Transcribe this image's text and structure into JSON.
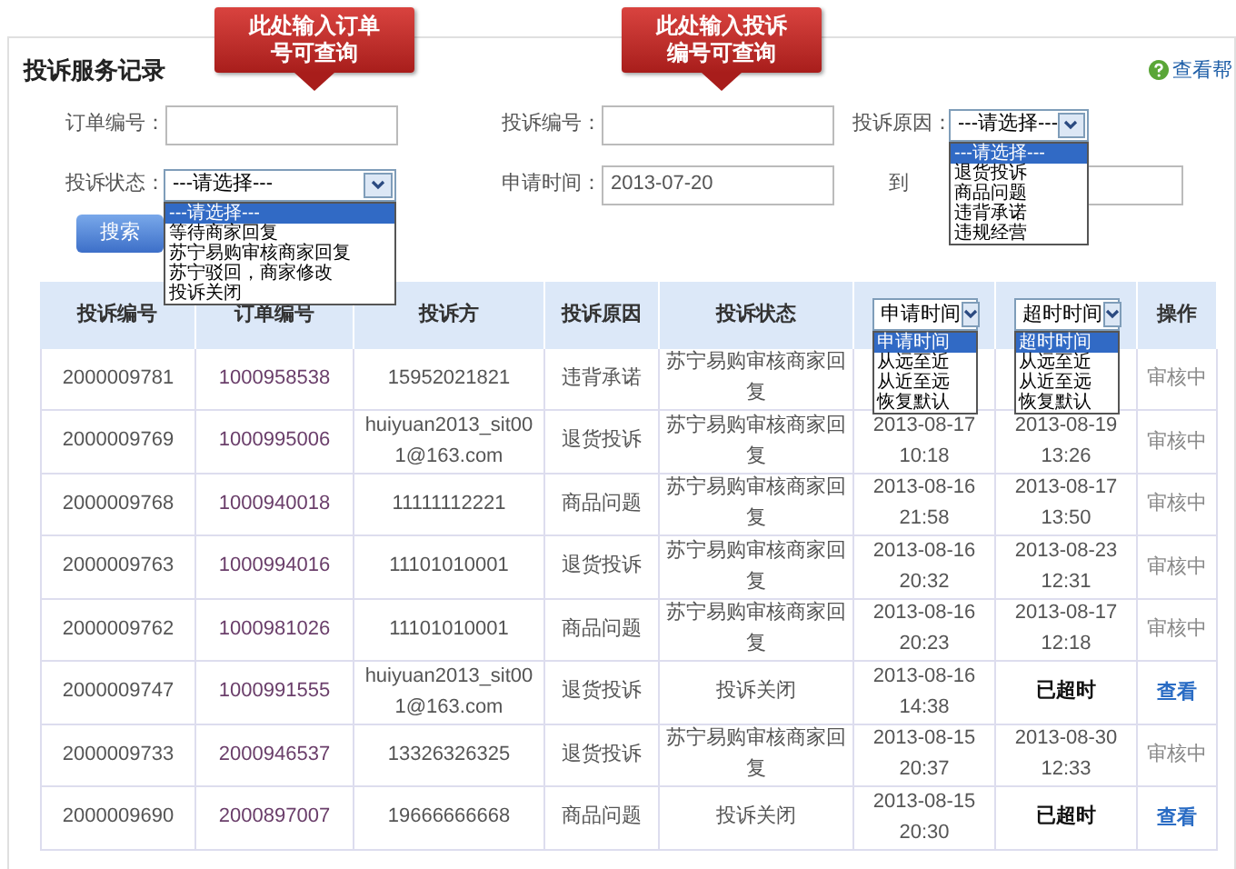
{
  "callouts": [
    "此处输入订单号可查询",
    "此处输入投诉编号可查询"
  ],
  "title": "投诉服务记录",
  "help_link": "查看帮",
  "filters": {
    "order_no": {
      "label": "订单编号："
    },
    "complaint_no": {
      "label": "投诉编号："
    },
    "reason": {
      "label": "投诉原因：",
      "value": "---请选择---",
      "expanded": true,
      "options": [
        {
          "label": "---请选择---",
          "selected": true
        },
        {
          "label": "退货投诉",
          "selected": false
        },
        {
          "label": "商品问题",
          "selected": false
        },
        {
          "label": "违背承诺",
          "selected": false
        },
        {
          "label": "违规经营",
          "selected": false
        }
      ]
    },
    "status": {
      "label": "投诉状态：",
      "value": "---请选择---",
      "expanded": true,
      "options": [
        {
          "label": "---请选择---",
          "selected": true
        },
        {
          "label": "等待商家回复",
          "selected": false
        },
        {
          "label": "苏宁易购审核商家回复",
          "selected": false
        },
        {
          "label": "苏宁驳回，商家修改",
          "selected": false
        },
        {
          "label": "投诉关闭",
          "selected": false
        }
      ]
    },
    "apply_time": {
      "label": "申请时间：",
      "value": "2013-07-20"
    },
    "to": {
      "label": "到"
    },
    "search_button": "搜索"
  },
  "table": {
    "columns": [
      {
        "kind": "text",
        "label": "投诉编号"
      },
      {
        "kind": "text",
        "label": "订单编号"
      },
      {
        "kind": "text",
        "label": "投诉方"
      },
      {
        "kind": "text",
        "label": "投诉原因"
      },
      {
        "kind": "text",
        "label": "投诉状态"
      },
      {
        "kind": "select",
        "value": "申请时间",
        "expanded": true,
        "options": [
          {
            "label": "申请时间",
            "selected": true
          },
          {
            "label": "从远至近",
            "selected": false
          },
          {
            "label": "从近至远",
            "selected": false
          },
          {
            "label": "恢复默认",
            "selected": false
          }
        ]
      },
      {
        "kind": "select",
        "value": "超时时间",
        "expanded": true,
        "options": [
          {
            "label": "超时时间",
            "selected": true
          },
          {
            "label": "从远至近",
            "selected": false
          },
          {
            "label": "从近至远",
            "selected": false
          },
          {
            "label": "恢复默认",
            "selected": false
          }
        ]
      },
      {
        "kind": "text",
        "label": "操作"
      }
    ],
    "rows": [
      {
        "id": "2000009781",
        "order": "1000958538",
        "complainant": "15952021821",
        "reason": "违背承诺",
        "status": "苏宁易购审核商家回复",
        "action": {
          "kind": "status",
          "text": "审核中"
        }
      },
      {
        "id": "2000009769",
        "order": "1000995006",
        "complainant": "huiyuan2013_sit001@163.com",
        "reason": "退货投诉",
        "status": "苏宁易购审核商家回复",
        "apply_time": "2013-08-17 10:18",
        "timeout": "2013-08-19 13:26",
        "expired": false,
        "action": {
          "kind": "status",
          "text": "审核中"
        }
      },
      {
        "id": "2000009768",
        "order": "1000940018",
        "complainant": "11111112221",
        "reason": "商品问题",
        "status": "苏宁易购审核商家回复",
        "apply_time": "2013-08-16 21:58",
        "timeout": "2013-08-17 13:50",
        "expired": false,
        "action": {
          "kind": "status",
          "text": "审核中"
        }
      },
      {
        "id": "2000009763",
        "order": "1000994016",
        "complainant": "11101010001",
        "reason": "退货投诉",
        "status": "苏宁易购审核商家回复",
        "apply_time": "2013-08-16 20:32",
        "timeout": "2013-08-23 12:31",
        "expired": false,
        "action": {
          "kind": "status",
          "text": "审核中"
        }
      },
      {
        "id": "2000009762",
        "order": "1000981026",
        "complainant": "11101010001",
        "reason": "商品问题",
        "status": "苏宁易购审核商家回复",
        "apply_time": "2013-08-16 20:23",
        "timeout": "2013-08-17 12:18",
        "expired": false,
        "action": {
          "kind": "status",
          "text": "审核中"
        }
      },
      {
        "id": "2000009747",
        "order": "1000991555",
        "complainant": "huiyuan2013_sit001@163.com",
        "reason": "退货投诉",
        "status": "投诉关闭",
        "apply_time": "2013-08-16 14:38",
        "timeout": "已超时",
        "expired": true,
        "action": {
          "kind": "link",
          "text": "查看"
        }
      },
      {
        "id": "2000009733",
        "order": "2000946537",
        "complainant": "13326326325",
        "reason": "退货投诉",
        "status": "苏宁易购审核商家回复",
        "apply_time": "2013-08-15 20:37",
        "timeout": "2013-08-30 12:33",
        "expired": false,
        "action": {
          "kind": "status",
          "text": "审核中"
        }
      },
      {
        "id": "2000009690",
        "order": "2000897007",
        "complainant": "19666666668",
        "reason": "商品问题",
        "status": "投诉关闭",
        "apply_time": "2013-08-15 20:30",
        "timeout": "已超时",
        "expired": true,
        "action": {
          "kind": "link",
          "text": "查看"
        }
      }
    ]
  }
}
